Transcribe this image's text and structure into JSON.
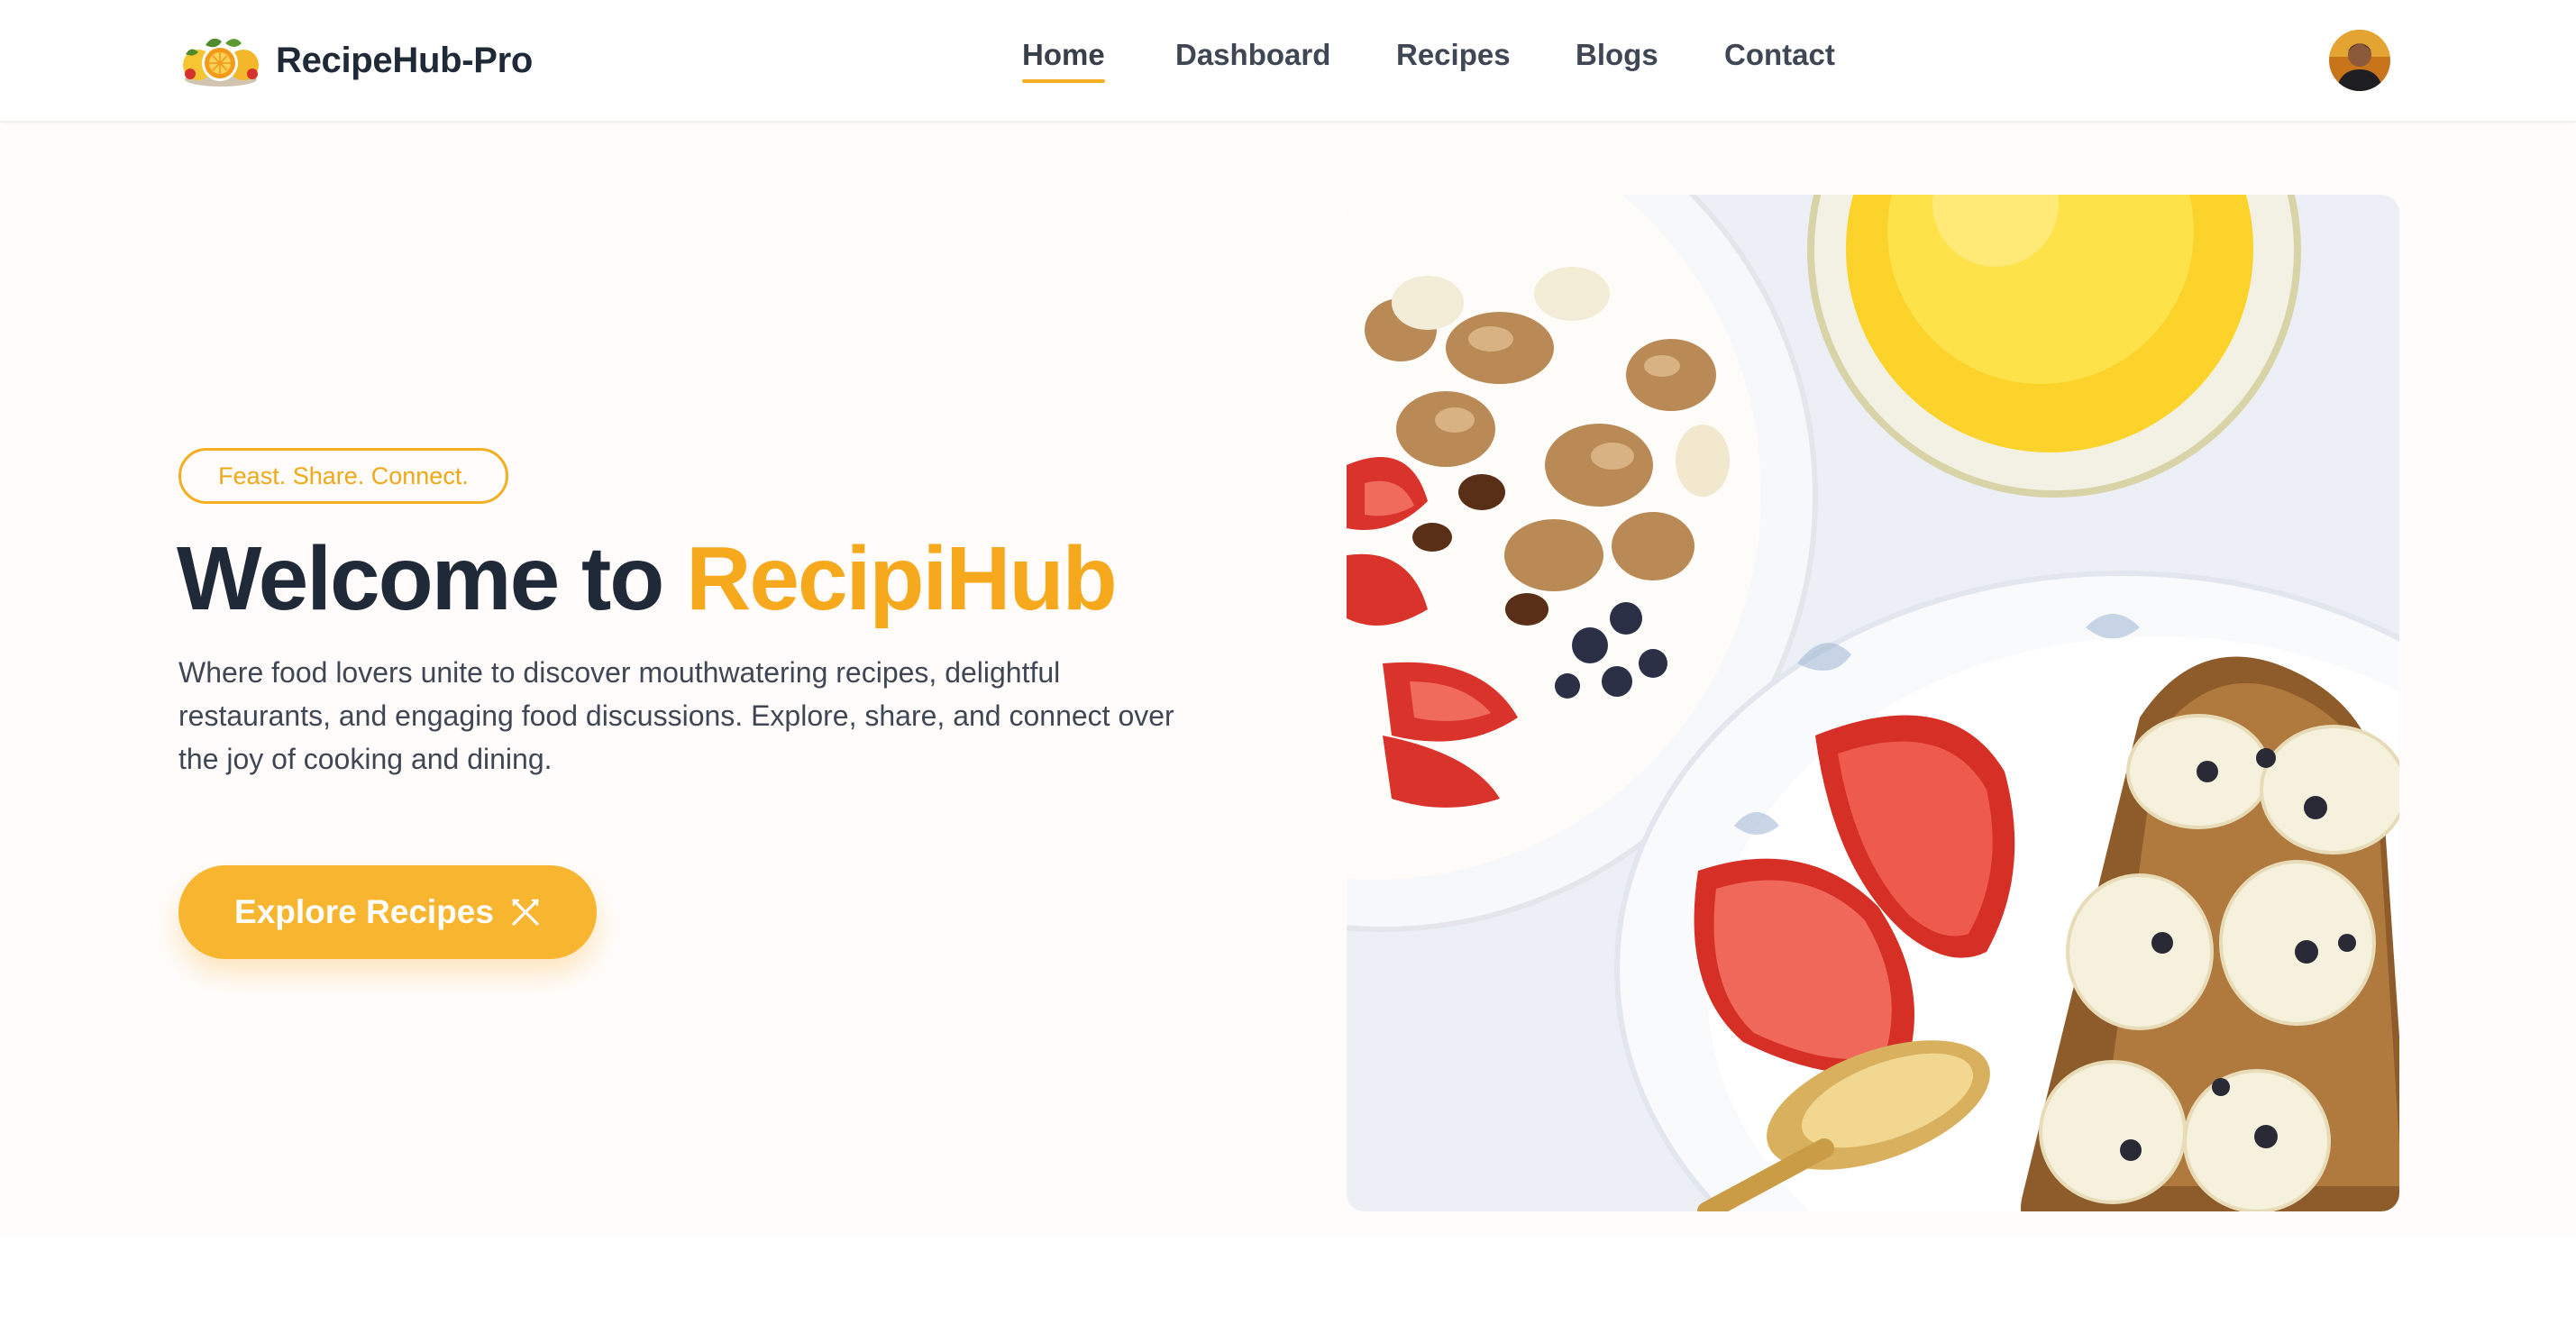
{
  "brand": {
    "name": "RecipeHub-Pro",
    "logo_icon": "citrus-fruits-logo"
  },
  "nav": {
    "items": [
      {
        "label": "Home",
        "active": true
      },
      {
        "label": "Dashboard",
        "active": false
      },
      {
        "label": "Recipes",
        "active": false
      },
      {
        "label": "Blogs",
        "active": false
      },
      {
        "label": "Contact",
        "active": false
      }
    ],
    "avatar_icon": "user-avatar"
  },
  "hero": {
    "tagline": "Feast. Share. Connect.",
    "headline_prefix": "Welcome to",
    "headline_accent": "RecipiHub",
    "description": "Where food lovers unite to discover mouthwatering recipes, delightful restaurants, and engaging food discussions. Explore, share, and connect over the joy of cooking and dining.",
    "cta_label": "Explore Recipes",
    "cta_icon": "utensils-crossed-icon",
    "image_icon": "breakfast-photo"
  },
  "colors": {
    "accent": "#f6a91c",
    "button": "#f8b52f",
    "text_dark": "#1f2937",
    "text_body": "#3f4754",
    "hero_bg": "#fffcfb"
  }
}
